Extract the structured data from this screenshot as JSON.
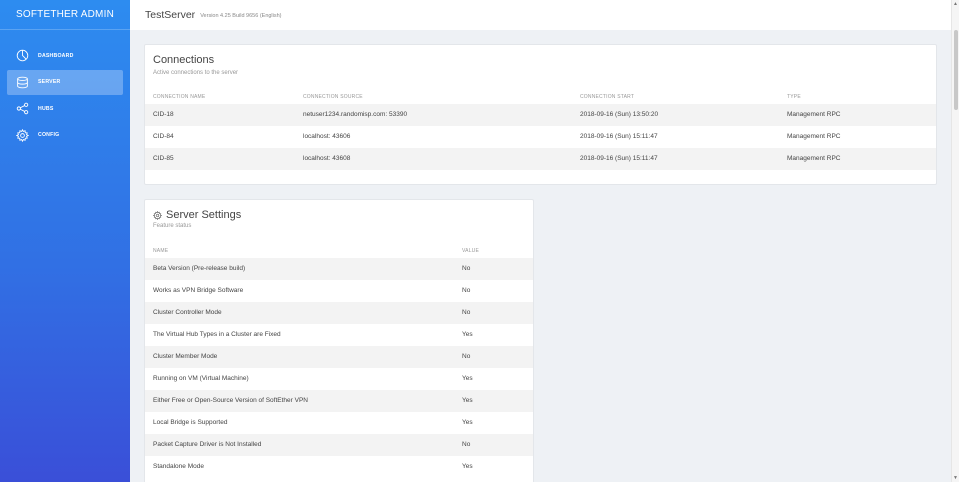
{
  "sidebar": {
    "brand": "SOFTETHER ADMIN",
    "items": [
      {
        "label": "DASHBOARD",
        "icon": "dashboard-icon",
        "active": false
      },
      {
        "label": "SERVER",
        "icon": "database-icon",
        "active": true
      },
      {
        "label": "HUBS",
        "icon": "share-icon",
        "active": false
      },
      {
        "label": "CONFIG",
        "icon": "gear-icon",
        "active": false
      }
    ]
  },
  "header": {
    "title": "TestServer",
    "version": "Version 4.25 Build 9656 (English)"
  },
  "connections": {
    "title": "Connections",
    "subtitle": "Active connections to the server",
    "columns": [
      "CONNECTION NAME",
      "CONNECTION SOURCE",
      "CONNECTION START",
      "TYPE"
    ],
    "rows": [
      [
        "CID-18",
        "netuser1234.randomisp.com: 53390",
        "2018-09-16 (Sun) 13:50:20",
        "Management RPC"
      ],
      [
        "CID-84",
        "localhost: 43606",
        "2018-09-16 (Sun) 15:11:47",
        "Management RPC"
      ],
      [
        "CID-85",
        "localhost: 43608",
        "2018-09-16 (Sun) 15:11:47",
        "Management RPC"
      ]
    ]
  },
  "settings": {
    "title": "Server Settings",
    "subtitle": "Feature status",
    "columns": [
      "NAME",
      "VALUE"
    ],
    "rows": [
      [
        "Beta Version (Pre-release build)",
        "No"
      ],
      [
        "Works as VPN Bridge Software",
        "No"
      ],
      [
        "Cluster Controller Mode",
        "No"
      ],
      [
        "The Virtual Hub Types in a Cluster are Fixed",
        "Yes"
      ],
      [
        "Cluster Member Mode",
        "No"
      ],
      [
        "Running on VM (Virtual Machine)",
        "Yes"
      ],
      [
        "Either Free or Open-Source Version of SoftEther VPN",
        "Yes"
      ],
      [
        "Local Bridge is Supported",
        "Yes"
      ],
      [
        "Packet Capture Driver is Not Installed",
        "No"
      ],
      [
        "Standalone Mode",
        "Yes"
      ]
    ]
  },
  "colors": {
    "sidebar_top": "#2d8cf0",
    "sidebar_bottom": "#3a4fd8",
    "row_shade": "#f3f3f3"
  }
}
